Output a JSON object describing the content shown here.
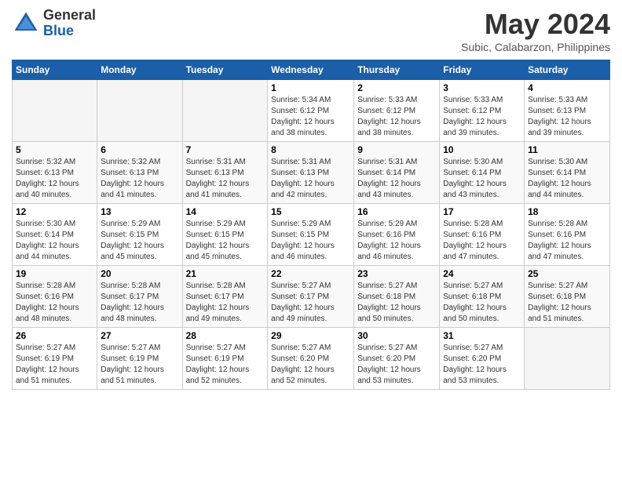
{
  "header": {
    "logo_general": "General",
    "logo_blue": "Blue",
    "month_title": "May 2024",
    "subtitle": "Subic, Calabarzon, Philippines"
  },
  "days_of_week": [
    "Sunday",
    "Monday",
    "Tuesday",
    "Wednesday",
    "Thursday",
    "Friday",
    "Saturday"
  ],
  "weeks": [
    [
      {
        "day": "",
        "info": ""
      },
      {
        "day": "",
        "info": ""
      },
      {
        "day": "",
        "info": ""
      },
      {
        "day": "1",
        "info": "Sunrise: 5:34 AM\nSunset: 6:12 PM\nDaylight: 12 hours\nand 38 minutes."
      },
      {
        "day": "2",
        "info": "Sunrise: 5:33 AM\nSunset: 6:12 PM\nDaylight: 12 hours\nand 38 minutes."
      },
      {
        "day": "3",
        "info": "Sunrise: 5:33 AM\nSunset: 6:12 PM\nDaylight: 12 hours\nand 39 minutes."
      },
      {
        "day": "4",
        "info": "Sunrise: 5:33 AM\nSunset: 6:13 PM\nDaylight: 12 hours\nand 39 minutes."
      }
    ],
    [
      {
        "day": "5",
        "info": "Sunrise: 5:32 AM\nSunset: 6:13 PM\nDaylight: 12 hours\nand 40 minutes."
      },
      {
        "day": "6",
        "info": "Sunrise: 5:32 AM\nSunset: 6:13 PM\nDaylight: 12 hours\nand 41 minutes."
      },
      {
        "day": "7",
        "info": "Sunrise: 5:31 AM\nSunset: 6:13 PM\nDaylight: 12 hours\nand 41 minutes."
      },
      {
        "day": "8",
        "info": "Sunrise: 5:31 AM\nSunset: 6:13 PM\nDaylight: 12 hours\nand 42 minutes."
      },
      {
        "day": "9",
        "info": "Sunrise: 5:31 AM\nSunset: 6:14 PM\nDaylight: 12 hours\nand 43 minutes."
      },
      {
        "day": "10",
        "info": "Sunrise: 5:30 AM\nSunset: 6:14 PM\nDaylight: 12 hours\nand 43 minutes."
      },
      {
        "day": "11",
        "info": "Sunrise: 5:30 AM\nSunset: 6:14 PM\nDaylight: 12 hours\nand 44 minutes."
      }
    ],
    [
      {
        "day": "12",
        "info": "Sunrise: 5:30 AM\nSunset: 6:14 PM\nDaylight: 12 hours\nand 44 minutes."
      },
      {
        "day": "13",
        "info": "Sunrise: 5:29 AM\nSunset: 6:15 PM\nDaylight: 12 hours\nand 45 minutes."
      },
      {
        "day": "14",
        "info": "Sunrise: 5:29 AM\nSunset: 6:15 PM\nDaylight: 12 hours\nand 45 minutes."
      },
      {
        "day": "15",
        "info": "Sunrise: 5:29 AM\nSunset: 6:15 PM\nDaylight: 12 hours\nand 46 minutes."
      },
      {
        "day": "16",
        "info": "Sunrise: 5:29 AM\nSunset: 6:16 PM\nDaylight: 12 hours\nand 46 minutes."
      },
      {
        "day": "17",
        "info": "Sunrise: 5:28 AM\nSunset: 6:16 PM\nDaylight: 12 hours\nand 47 minutes."
      },
      {
        "day": "18",
        "info": "Sunrise: 5:28 AM\nSunset: 6:16 PM\nDaylight: 12 hours\nand 47 minutes."
      }
    ],
    [
      {
        "day": "19",
        "info": "Sunrise: 5:28 AM\nSunset: 6:16 PM\nDaylight: 12 hours\nand 48 minutes."
      },
      {
        "day": "20",
        "info": "Sunrise: 5:28 AM\nSunset: 6:17 PM\nDaylight: 12 hours\nand 48 minutes."
      },
      {
        "day": "21",
        "info": "Sunrise: 5:28 AM\nSunset: 6:17 PM\nDaylight: 12 hours\nand 49 minutes."
      },
      {
        "day": "22",
        "info": "Sunrise: 5:27 AM\nSunset: 6:17 PM\nDaylight: 12 hours\nand 49 minutes."
      },
      {
        "day": "23",
        "info": "Sunrise: 5:27 AM\nSunset: 6:18 PM\nDaylight: 12 hours\nand 50 minutes."
      },
      {
        "day": "24",
        "info": "Sunrise: 5:27 AM\nSunset: 6:18 PM\nDaylight: 12 hours\nand 50 minutes."
      },
      {
        "day": "25",
        "info": "Sunrise: 5:27 AM\nSunset: 6:18 PM\nDaylight: 12 hours\nand 51 minutes."
      }
    ],
    [
      {
        "day": "26",
        "info": "Sunrise: 5:27 AM\nSunset: 6:19 PM\nDaylight: 12 hours\nand 51 minutes."
      },
      {
        "day": "27",
        "info": "Sunrise: 5:27 AM\nSunset: 6:19 PM\nDaylight: 12 hours\nand 51 minutes."
      },
      {
        "day": "28",
        "info": "Sunrise: 5:27 AM\nSunset: 6:19 PM\nDaylight: 12 hours\nand 52 minutes."
      },
      {
        "day": "29",
        "info": "Sunrise: 5:27 AM\nSunset: 6:20 PM\nDaylight: 12 hours\nand 52 minutes."
      },
      {
        "day": "30",
        "info": "Sunrise: 5:27 AM\nSunset: 6:20 PM\nDaylight: 12 hours\nand 53 minutes."
      },
      {
        "day": "31",
        "info": "Sunrise: 5:27 AM\nSunset: 6:20 PM\nDaylight: 12 hours\nand 53 minutes."
      },
      {
        "day": "",
        "info": ""
      }
    ]
  ]
}
